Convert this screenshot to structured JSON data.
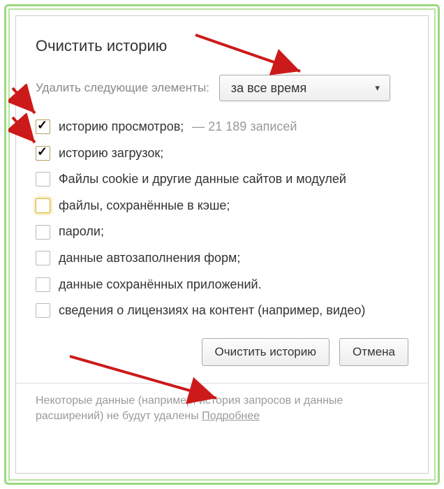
{
  "dialog": {
    "title": "Очистить историю",
    "period_label": "Удалить следующие элементы:",
    "period_value": "за все время",
    "options": [
      {
        "label": "историю просмотров;",
        "suffix": " — 21 189 записей",
        "checked": true,
        "style": "gold"
      },
      {
        "label": "историю загрузок;",
        "suffix": "",
        "checked": true,
        "style": "gold"
      },
      {
        "label": "Файлы cookie и другие данные сайтов и модулей",
        "suffix": "",
        "checked": false,
        "style": "gray"
      },
      {
        "label": "файлы, сохранённые в кэше;",
        "suffix": "",
        "checked": false,
        "style": "glow"
      },
      {
        "label": "пароли;",
        "suffix": "",
        "checked": false,
        "style": "gray"
      },
      {
        "label": "данные автозаполнения форм;",
        "suffix": "",
        "checked": false,
        "style": "gray"
      },
      {
        "label": "данные сохранённых приложений.",
        "suffix": "",
        "checked": false,
        "style": "gray"
      },
      {
        "label": "сведения о лицензиях на контент (например, видео)",
        "suffix": "",
        "checked": false,
        "style": "gray"
      }
    ],
    "buttons": {
      "clear": "Очистить историю",
      "cancel": "Отмена"
    },
    "footer_text": "Некоторые данные (например, история запросов и данные расширений) не будут удалены ",
    "footer_link": "Подробнее"
  }
}
